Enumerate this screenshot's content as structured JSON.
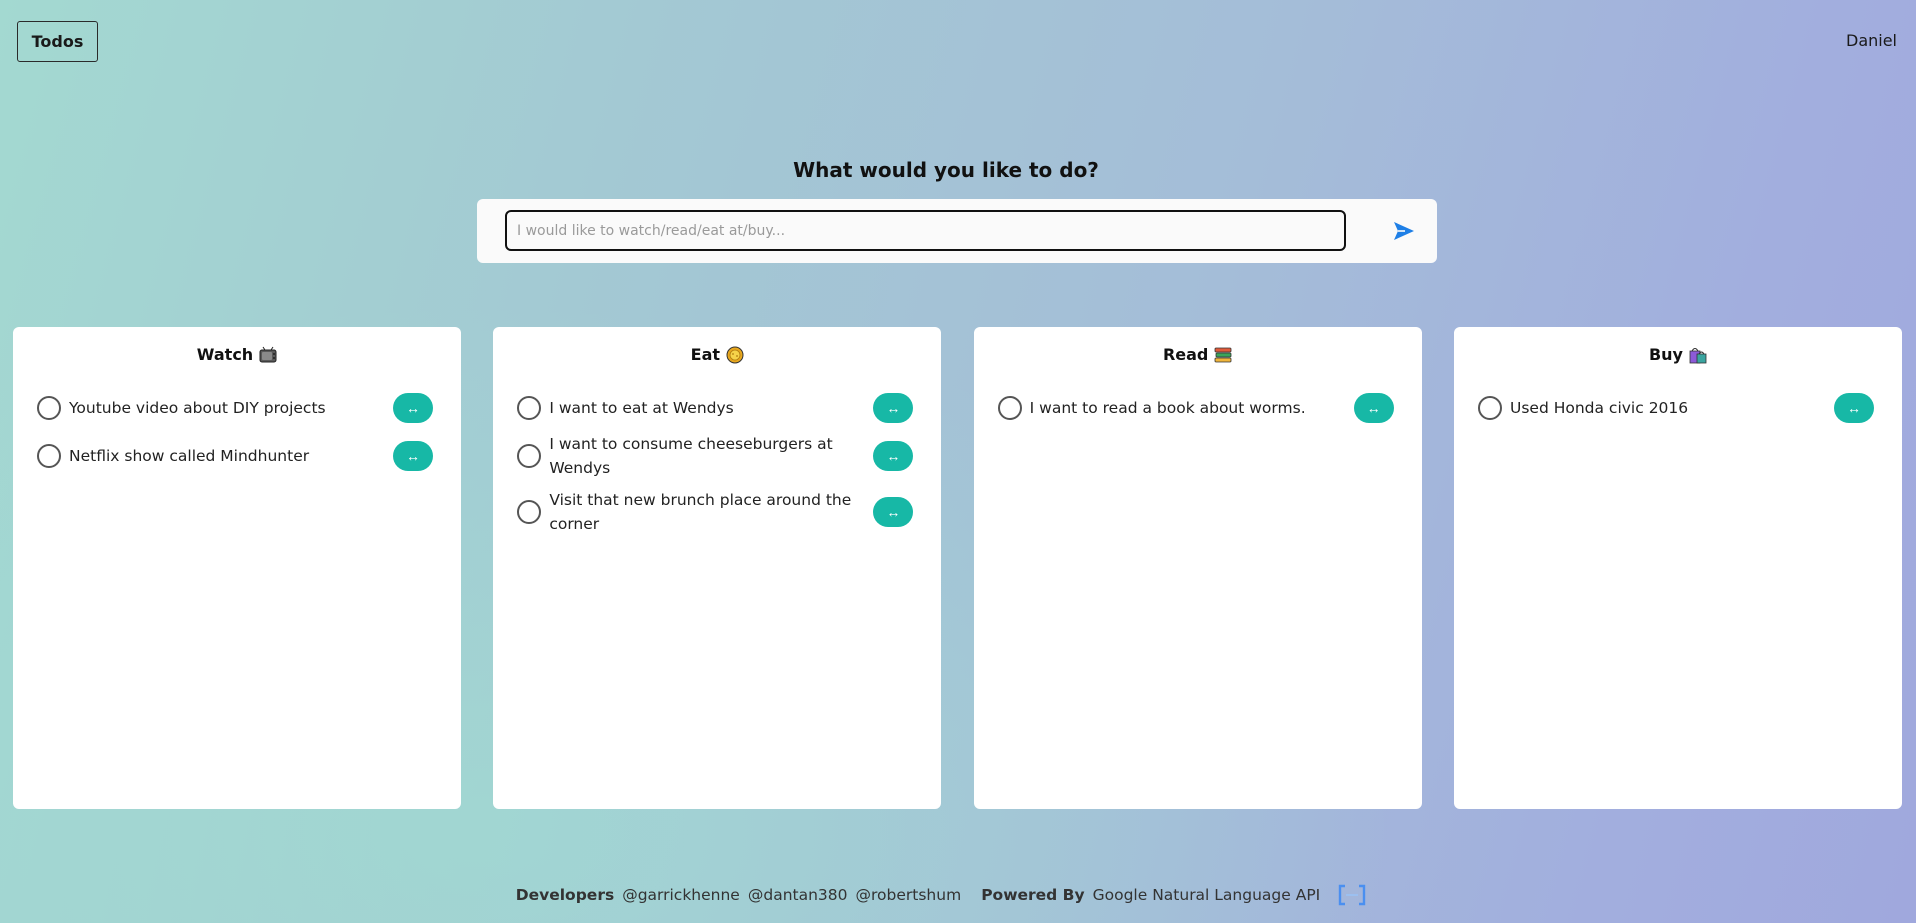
{
  "header": {
    "todos_label": "Todos",
    "user_name": "Daniel"
  },
  "prompt": {
    "title": "What would you like to do?",
    "placeholder": "I would like to watch/read/eat at/buy...",
    "value": ""
  },
  "columns": [
    {
      "title": "Watch",
      "emoji_icon": "tv-icon",
      "items": [
        {
          "text": "Youtube video about DIY projects"
        },
        {
          "text": "Netflix show called Mindhunter"
        }
      ]
    },
    {
      "title": "Eat",
      "emoji_icon": "food-icon",
      "items": [
        {
          "text": "I want to eat at Wendys"
        },
        {
          "text": "I want to consume cheeseburgers at Wendys"
        },
        {
          "text": "Visit that new brunch place around the corner"
        }
      ]
    },
    {
      "title": "Read",
      "emoji_icon": "books-icon",
      "items": [
        {
          "text": "I want to read a book about worms."
        }
      ]
    },
    {
      "title": "Buy",
      "emoji_icon": "shopping-bags-icon",
      "items": [
        {
          "text": "Used Honda civic 2016"
        }
      ]
    }
  ],
  "move_button_glyph": "↔",
  "footer": {
    "developers_label": "Developers",
    "developers": [
      "@garrickhenne",
      "@dantan380",
      "@robertshum"
    ],
    "powered_label": "Powered By",
    "powered_by": "Google Natural Language API"
  },
  "colors": {
    "accent": "#17b8a6",
    "send_icon": "#1e7fe6"
  }
}
